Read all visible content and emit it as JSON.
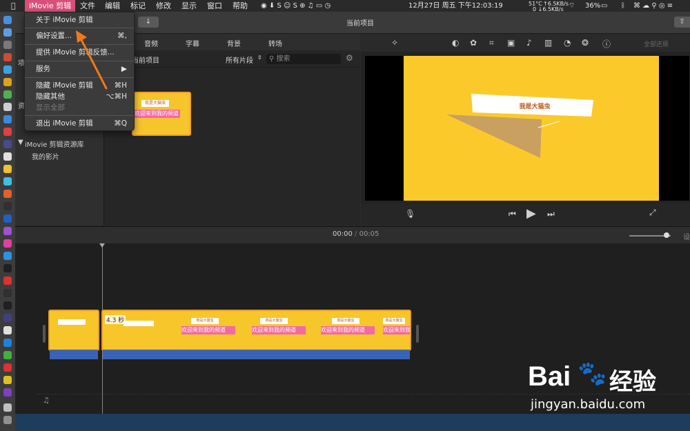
{
  "menubar": {
    "apple": "",
    "app_menu": "iMovie 剪辑",
    "items": [
      "文件",
      "编辑",
      "标记",
      "修改",
      "显示",
      "窗口",
      "帮助"
    ],
    "status": {
      "temp": "51°C",
      "net_up": "↑6.5KB/s",
      "net_down": "0 ↓6.5KB/s",
      "battery": "36%",
      "datetime": "12月27日 周五 下午12:03:19"
    }
  },
  "app_menu_dropdown": {
    "items": [
      {
        "label": "关于 iMovie 剪辑",
        "shortcut": "",
        "disabled": false
      },
      {
        "label": "偏好设置...",
        "shortcut": "⌘,",
        "disabled": false
      },
      {
        "label": "提供 iMovie 剪辑反馈...",
        "shortcut": "",
        "disabled": false
      },
      {
        "label": "服务",
        "shortcut": "▶",
        "disabled": false
      },
      {
        "label": "隐藏 iMovie 剪辑",
        "shortcut": "⌘H",
        "disabled": false
      },
      {
        "label": "隐藏其他",
        "shortcut": "⌥⌘H",
        "disabled": false
      },
      {
        "label": "显示全部",
        "shortcut": "",
        "disabled": true
      },
      {
        "label": "退出 iMovie 剪辑",
        "shortcut": "⌘Q",
        "disabled": false
      }
    ]
  },
  "toolbar": {
    "title": "当前项目"
  },
  "sidebar": {
    "partial_top": "项",
    "partial_mid": "资",
    "library": "iMovie 剪辑资源库",
    "my_movies": "我的影片"
  },
  "browser": {
    "tabs": [
      "音频",
      "字幕",
      "背景",
      "转场"
    ],
    "project_label": "当前项目",
    "filter": "所有片段",
    "search_placeholder": "搜索",
    "thumb_title": "我是大猫虫",
    "thumb_caption": "欢迎来到我的频道"
  },
  "viewer": {
    "video_title": "我是大猫虫",
    "restore_all": "全部还原"
  },
  "timeline": {
    "timecode_current": "00:00",
    "timecode_sep": "/",
    "timecode_total": "00:05",
    "clip_duration": "4.3 秒",
    "clip_caption": "欢迎来到我的频道",
    "clip_title": "我是大猫虫",
    "settings_partial": "设"
  },
  "watermark": {
    "brand": "Bai",
    "brand_cn": "经验",
    "url": "jingyan.baidu.com"
  },
  "colors": {
    "accent_menu": "#d94f7a",
    "clip_yellow": "#f7c62b",
    "audio_blue": "#3b63b5",
    "arrow_orange": "#f07a1a"
  }
}
